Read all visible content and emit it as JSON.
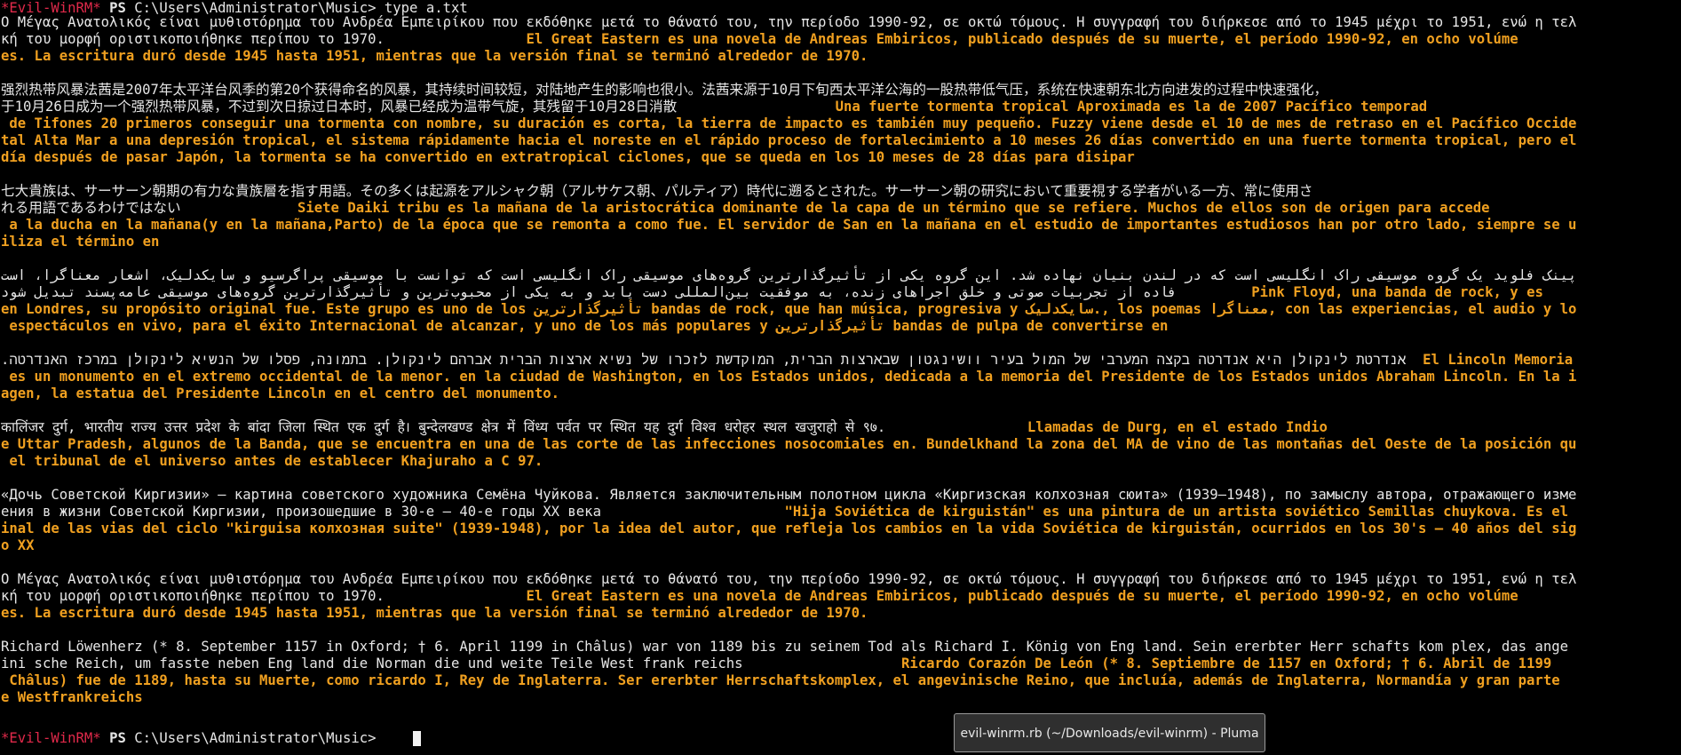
{
  "prompt": {
    "name": "*Evil-WinRM*",
    "ps": "PS",
    "path": "C:\\Users\\Administrator\\Music>",
    "command": "type a.txt"
  },
  "output": [
    {
      "segs": [
        {
          "c": "w",
          "t": "Ο Μέγας Ανατολικός είναι μυθιστόρημα του Ανδρέα Εμπειρίκου που εκδόθηκε μετά το θάνατό του, την περίοδο 1990-92, σε οκτώ τόμους. Η συγγραφή του διήρκεσε από το 1945 μέχρι το 1951, ενώ η τελ"
        }
      ]
    },
    {
      "segs": [
        {
          "c": "w",
          "t": "κή του μορφή οριστικοποιήθηκε περίπου το 1970.                 "
        },
        {
          "c": "o",
          "t": "El Great Eastern es una novela de Andreas Embiricos, publicado después de su muerte, el período 1990-92, en ocho volúme"
        }
      ]
    },
    {
      "segs": [
        {
          "c": "o",
          "t": "es. La escritura duró desde 1945 hasta 1951, mientras que la versión final se terminó alrededor de 1970."
        }
      ]
    },
    {
      "segs": []
    },
    {
      "segs": [
        {
          "c": "w",
          "t": "强烈热带风暴法茜是2007年太平洋台风季的第20个获得命名的风暴，其持续时间较短，对陆地产生的影响也很小。法茜来源于10月下旬西太平洋公海的一股热带低气压，系统在快速朝东北方向进发的过程中快速强化，"
        }
      ]
    },
    {
      "segs": [
        {
          "c": "w",
          "t": "于10月26日成为一个强烈热带风暴，不过到次日掠过日本时，风暴已经成为温带气旋，其残留于10月28日消散                   "
        },
        {
          "c": "o",
          "t": "Una fuerte tormenta tropical Aproximada es la de 2007 Pacífico temporad"
        }
      ]
    },
    {
      "segs": [
        {
          "c": "o",
          "t": " de Tifones 20 primeros conseguir una tormenta con nombre, su duración es corta, la tierra de impacto es también muy pequeño. Fuzzy viene desde el 10 de mes de retraso en el Pacífico Occide"
        }
      ]
    },
    {
      "segs": [
        {
          "c": "o",
          "t": "tal Alta Mar a una depresión tropical, el sistema rápidamente hacia el noreste en el rápido proceso de fortalecimiento a 10 meses 26 días convertido en una fuerte tormenta tropical, pero el"
        }
      ]
    },
    {
      "segs": [
        {
          "c": "o",
          "t": "día después de pasar Japón, la tormenta se ha convertido en extratropical ciclones, que se queda en los 10 meses de 28 días para disipar"
        }
      ]
    },
    {
      "segs": []
    },
    {
      "segs": [
        {
          "c": "w",
          "t": "七大貴族は、サーサーン朝期の有力な貴族層を指す用語。その多くは起源をアルシャク朝（アルサケス朝、パルティア）時代に遡るとされた。サーサーン朝の研究において重要視する学者がいる一方、常に使用さ"
        }
      ]
    },
    {
      "segs": [
        {
          "c": "w",
          "t": "れる用語であるわけではない              "
        },
        {
          "c": "o",
          "t": "Siete Daiki tribu es la mañana de la aristocrática dominante de la capa de un término que se refiere. Muchos de ellos son de origen para accede"
        }
      ]
    },
    {
      "segs": [
        {
          "c": "o",
          "t": " a la ducha en la mañana(y en la mañana,Parto) de la época que se remonta a como fue. El servidor de San en la mañana en el estudio de importantes estudiosos han por otro lado, siempre se u"
        }
      ]
    },
    {
      "segs": [
        {
          "c": "o",
          "t": "iliza el término en"
        }
      ]
    },
    {
      "segs": []
    },
    {
      "segs": [
        {
          "c": "w",
          "r": 1,
          "t": "پینک فلوید یک گروه موسیقی راک انگلیسی است که در لندن بنیان نهاده شد. این گروه یکی از تأثیرگذارترین گروه‌های موسیقی راک انگلیسی است که توانست با موسیقی پراگرسیو و سایکدلیک، اشعار معناگرا، است"
        }
      ]
    },
    {
      "segs": [
        {
          "c": "w",
          "r": 1,
          "t": "فاده از تجربیات صوتی و خلق اجراهای زنده، به موفقیت بین‌المللی دست یابد و به یکی از محبوب‌ترین و تأثیرگذارترین گروه‌های موسیقی عامه‌پسند تبدیل شود"
        },
        {
          "c": "o",
          "t": "         Pink Floyd, una banda de rock, y es"
        }
      ]
    },
    {
      "segs": [
        {
          "c": "o",
          "t": "en Londres, su propósito original fue. Este grupo es uno de los "
        },
        {
          "c": "o",
          "r": 1,
          "t": "تأثیرگذارترین"
        },
        {
          "c": "o",
          "t": " bandas de rock, que han música, progresiva y "
        },
        {
          "c": "o",
          "r": 1,
          "t": "سایکدلیک"
        },
        {
          "c": "o",
          "t": "., los poemas "
        },
        {
          "c": "o",
          "r": 1,
          "t": "معناگرا"
        },
        {
          "c": "o",
          "t": ", con las experiencias, el audio y lo"
        }
      ]
    },
    {
      "segs": [
        {
          "c": "o",
          "t": " espectáculos en vivo, para el éxito Internacional de alcanzar, y uno de los más populares y "
        },
        {
          "c": "o",
          "r": 1,
          "t": "تأثیرگذارترین"
        },
        {
          "c": "o",
          "t": " bandas de pulpa de convertirse en"
        }
      ]
    },
    {
      "segs": []
    },
    {
      "segs": [
        {
          "c": "w",
          "r": 1,
          "t": "אנדרטת לינקולן היא אנדרטה בקצה המערבי של המול בעיר וושינגטון שבארצות הברית, המוקדשת לזכרו של נשיא ארצות הברית אברהם לינקולן. בתמונה, פסלו של הנשיא לינקולן במרכז האנדרטה."
        },
        {
          "c": "o",
          "t": "  El Lincoln Memoria"
        }
      ]
    },
    {
      "segs": [
        {
          "c": "o",
          "t": " es un monumento en el extremo occidental de la menor. en la ciudad de Washington, en los Estados unidos, dedicada a la memoria del Presidente de los Estados unidos Abraham Lincoln. En la i"
        }
      ]
    },
    {
      "segs": [
        {
          "c": "o",
          "t": "agen, la estatua del Presidente Lincoln en el centro del monumento."
        }
      ]
    },
    {
      "segs": []
    },
    {
      "segs": [
        {
          "c": "w",
          "t": "कालिंजर दुर्ग, भारतीय राज्य उत्तर प्रदेश के बांदा जिला स्थित एक दुर्ग है। बुन्देलखण्ड क्षेत्र में विंध्य पर्वत पर स्थित यह दुर्ग विश्व धरोहर स्थल खजुराहो से ९७.                 "
        },
        {
          "c": "o",
          "t": "Llamadas de Durg, en el estado Indio"
        }
      ]
    },
    {
      "segs": [
        {
          "c": "o",
          "t": "e Uttar Pradesh, algunos de la Banda, que se encuentra en una de las corte de las infecciones nosocomiales en. Bundelkhand la zona del MA de vino de las montañas del Oeste de la posición qu"
        }
      ]
    },
    {
      "segs": [
        {
          "c": "o",
          "t": " el tribunal de el universo antes de establecer Khajuraho a C 97."
        }
      ]
    },
    {
      "segs": []
    },
    {
      "segs": [
        {
          "c": "w",
          "t": "«Дочь Советской Киргизии» — картина советского художника Семёна Чуйкова. Является заключительным полотном цикла «Киргизская колхозная сюита» (1939—1948), по замыслу автора, отражающего изме"
        }
      ]
    },
    {
      "segs": [
        {
          "c": "w",
          "t": "ения в жизни Советской Киргизии, произошедшие в 30-е — 40-е годы XX века                      "
        },
        {
          "c": "o",
          "t": "\"Hija Soviética de kirguistán\" es una pintura de un artista soviético Semillas chuykova. Es el"
        }
      ]
    },
    {
      "segs": [
        {
          "c": "o",
          "t": "inal de las vias del ciclo \"kirguisa колхозная suite\" (1939-1948), por la idea del autor, que refleja los cambios en la vida Soviética de kirguistán, ocurridos en los 30's — 40 años del sig"
        }
      ]
    },
    {
      "segs": [
        {
          "c": "o",
          "t": "o XX"
        }
      ]
    },
    {
      "segs": []
    },
    {
      "segs": [
        {
          "c": "w",
          "t": "Ο Μέγας Ανατολικός είναι μυθιστόρημα του Ανδρέα Εμπειρίκου που εκδόθηκε μετά το θάνατό του, την περίοδο 1990-92, σε οκτώ τόμους. Η συγγραφή του διήρκεσε από το 1945 μέχρι το 1951, ενώ η τελ"
        }
      ]
    },
    {
      "segs": [
        {
          "c": "w",
          "t": "κή του μορφή οριστικοποιήθηκε περίπου το 1970.                 "
        },
        {
          "c": "o",
          "t": "El Great Eastern es una novela de Andreas Embiricos, publicado después de su muerte, el período 1990-92, en ocho volúme"
        }
      ]
    },
    {
      "segs": [
        {
          "c": "o",
          "t": "es. La escritura duró desde 1945 hasta 1951, mientras que la versión final se terminó alrededor de 1970."
        }
      ]
    },
    {
      "segs": []
    },
    {
      "segs": [
        {
          "c": "w",
          "t": "Richard Löwenherz (* 8. September 1157 in Oxford; † 6. April 1199 in Châlus) war von 1189 bis zu seinem Tod als Richard I. König von Eng land. Sein ererbter Herr schafts kom plex, das ange"
        }
      ]
    },
    {
      "segs": [
        {
          "c": "w",
          "t": "ini sche Reich, um fasste neben Eng land die Norman die und weite Teile West frank reichs                   "
        },
        {
          "c": "o",
          "t": "Ricardo Corazón De León (* 8. Septiembre de 1157 en Oxford; † 6. Abril de 1199"
        }
      ]
    },
    {
      "segs": [
        {
          "c": "o",
          "t": " Châlus) fue de 1189, hasta su Muerte, como ricardo I, Rey de Inglaterra. Ser ererbter Herrschaftskomplex, el angevinische Reino, que incluía, además de Inglaterra, Normandía y gran parte"
        }
      ]
    },
    {
      "segs": [
        {
          "c": "o",
          "t": "e Westfrankreichs"
        }
      ]
    },
    {
      "segs": []
    }
  ],
  "tooltip": {
    "text": "evil-winrm.rb (~/Downloads/evil-winrm) - Pluma"
  }
}
